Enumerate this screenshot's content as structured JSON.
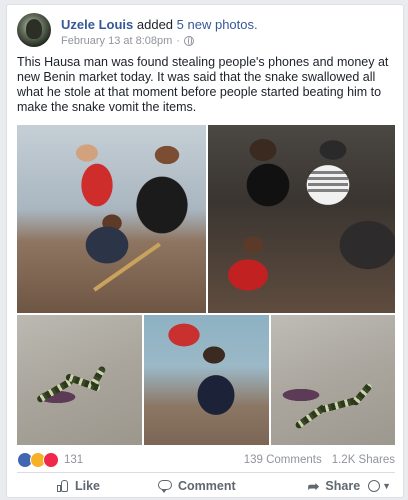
{
  "post": {
    "author": "Uzele Louis",
    "action": "added",
    "photos_link": "5 new photos.",
    "timestamp": "February 13 at 8:08pm",
    "text": "This Hausa man was found stealing people's phones and money at new Benin market today. It was said that the snake swallowed all what he stole at that moment before people started beating him to make the snake vomit the items."
  },
  "reactions": {
    "count": "131",
    "types": [
      "like",
      "haha",
      "love"
    ],
    "comments": "139 Comments",
    "shares": "1.2K Shares"
  },
  "actions": {
    "like_label": "Like",
    "comment_label": "Comment",
    "share_label": "Share"
  },
  "colors": {
    "link": "#365899",
    "like": "#4267b2",
    "haha": "#f7b125",
    "love": "#f0284a"
  }
}
